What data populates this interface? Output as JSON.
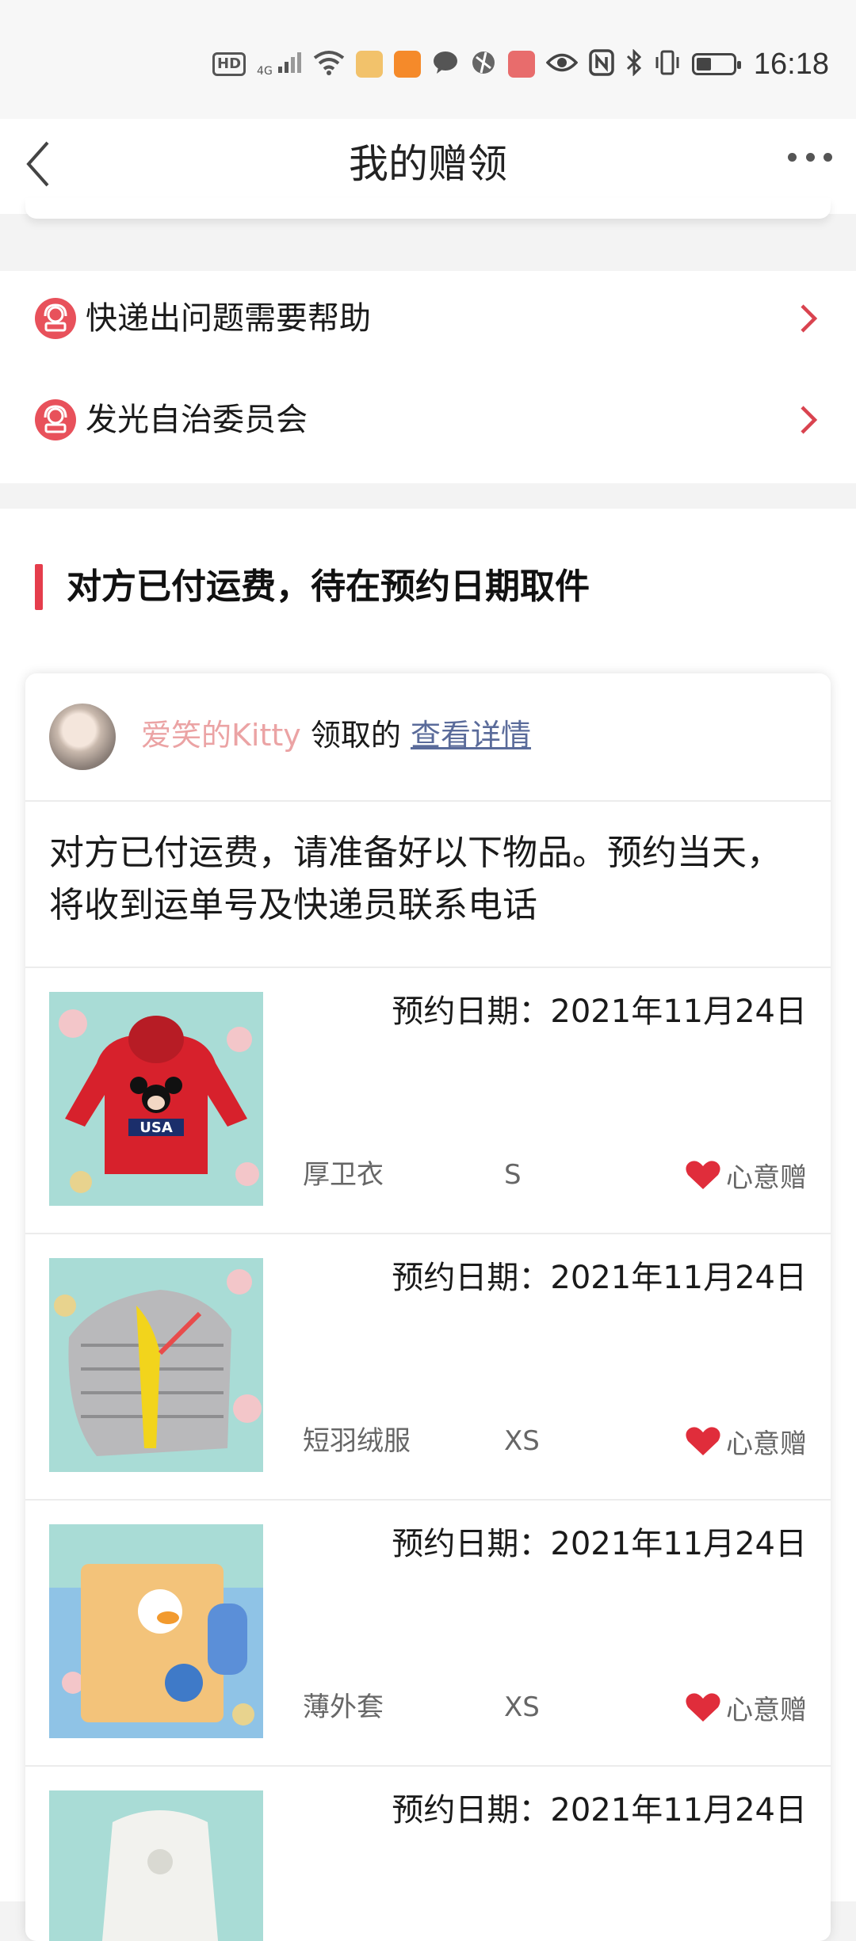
{
  "status_bar": {
    "time": "16:18",
    "hd": "HD",
    "signal": "4G"
  },
  "nav": {
    "title": "我的赠领"
  },
  "help_links": [
    {
      "label": "快递出问题需要帮助"
    },
    {
      "label": "发光自治委员会"
    }
  ],
  "section": {
    "title": "对方已付运费，待在预约日期取件"
  },
  "card": {
    "claimer_name": "爱笑的Kitty",
    "claim_word": "领取的",
    "detail_link": "查看详情",
    "notice": "对方已付运费，请准备好以下物品。预约当天，将收到运单号及快递员联系电话",
    "items": [
      {
        "date": "预约日期：2021年11月24日",
        "name": "厚卫衣",
        "size": "S",
        "gift_label": "心意赠"
      },
      {
        "date": "预约日期：2021年11月24日",
        "name": "短羽绒服",
        "size": "XS",
        "gift_label": "心意赠"
      },
      {
        "date": "预约日期：2021年11月24日",
        "name": "薄外套",
        "size": "XS",
        "gift_label": "心意赠"
      },
      {
        "date": "预约日期：2021年11月24日",
        "name": "",
        "size": "",
        "gift_label": ""
      }
    ]
  },
  "colors": {
    "accent": "#e53d4c",
    "claimer": "#eba3a4",
    "link": "#5a6b9a",
    "icon_bg": "#e8515b"
  }
}
